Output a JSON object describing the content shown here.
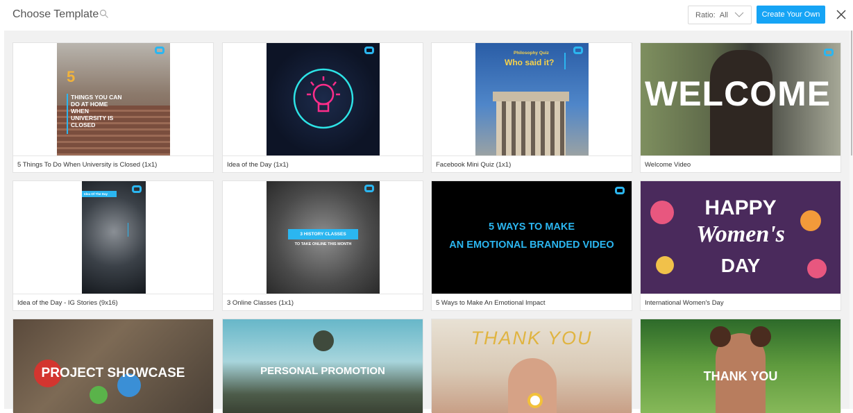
{
  "header": {
    "title": "Choose Template",
    "ratio_label": "Ratio:",
    "ratio_value": "All",
    "create_label": "Create Your Own"
  },
  "templates": [
    {
      "caption": "5 Things To Do When University is Closed (1x1)",
      "art": {
        "number": "5",
        "lines": [
          "THINGS YOU CAN",
          "DO AT HOME",
          "WHEN",
          "UNIVERSITY IS",
          "CLOSED"
        ]
      }
    },
    {
      "caption": "Idea of the Day (1x1)"
    },
    {
      "caption": "Facebook Mini Quiz (1x1)",
      "art": {
        "small": "Philosophy Quiz",
        "big": "Who said it?"
      }
    },
    {
      "caption": "Welcome Video",
      "art": {
        "big": "WELCOME"
      }
    },
    {
      "caption": "Idea of the Day - IG Stories (9x16)",
      "art": {
        "tag": "Idea Of The Day"
      }
    },
    {
      "caption": "3 Online Classes (1x1)",
      "art": {
        "tag": "3 HISTORY CLASSES",
        "sub": "TO TAKE ONLINE THIS MONTH"
      }
    },
    {
      "caption": "5 Ways to Make An Emotional Impact",
      "art": {
        "line1": "5 WAYS TO MAKE",
        "line2": "AN EMOTIONAL BRANDED VIDEO"
      }
    },
    {
      "caption": "International Women's Day",
      "art": {
        "line1": "HAPPY",
        "line2": "Women's",
        "line3": "DAY"
      }
    },
    {
      "caption": "",
      "art": {
        "big": "PROJECT SHOWCASE"
      }
    },
    {
      "caption": "",
      "art": {
        "big": "PERSONAL PROMOTION"
      }
    },
    {
      "caption": "",
      "art": {
        "big": "THANK YOU"
      }
    },
    {
      "caption": "",
      "art": {
        "big": "THANK YOU"
      }
    }
  ],
  "colors": {
    "accent": "#16a4f5",
    "logo": "#2bb6f0",
    "background": "#f1f1f1"
  }
}
